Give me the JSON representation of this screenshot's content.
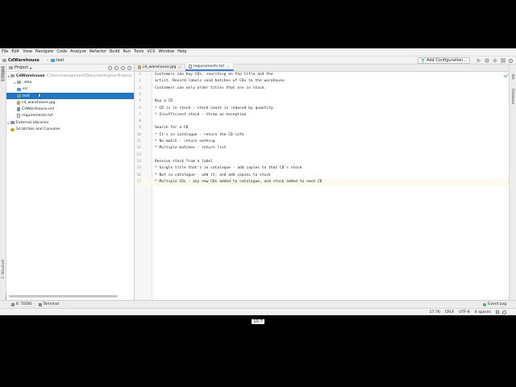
{
  "menu": [
    "File",
    "Edit",
    "View",
    "Navigate",
    "Code",
    "Analyze",
    "Refactor",
    "Build",
    "Run",
    "Tools",
    "VCS",
    "Window",
    "Help"
  ],
  "breadcrumb": {
    "project": "CdWarehouse",
    "folder": "test"
  },
  "toolbar": {
    "add_configuration": "Add Configuration..."
  },
  "project_panel": {
    "title": "Project",
    "tree": [
      {
        "label": "CdWarehouse",
        "path": "C:\\Users\\assignment\\Documents\\Java Projects",
        "icon": "folder-icon"
      },
      {
        "label": ".idea",
        "icon": "folder-icon"
      },
      {
        "label": "src",
        "icon": "source-folder-icon"
      },
      {
        "label": "test",
        "icon": "test-folder-icon"
      },
      {
        "label": "cd_warehouse.jpg",
        "icon": "image-file-icon"
      },
      {
        "label": "CdWarehouse.iml",
        "icon": "module-file-icon"
      },
      {
        "label": "requirements.txt",
        "icon": "text-file-icon"
      },
      {
        "label": "External Libraries",
        "icon": "library-icon"
      },
      {
        "label": "Scratches and Consoles",
        "icon": "scratch-icon"
      }
    ]
  },
  "editor": {
    "tabs": [
      {
        "label": "cd_warehouse.jpg",
        "active": false
      },
      {
        "label": "requirements.txt",
        "active": true
      }
    ],
    "lines": [
      {
        "n": "1",
        "text": "Customers can buy CDs, searching on the title and the"
      },
      {
        "n": "2",
        "text": "artist. Record labels send batches of CDs to the warehouse."
      },
      {
        "n": "3",
        "text": "Customers can only order titles that are in stock."
      },
      {
        "n": "4",
        "text": ""
      },
      {
        "n": "5",
        "text": "Buy a CD"
      },
      {
        "n": "6",
        "text": "* CD is in stock - stock count is reduced by quantity"
      },
      {
        "n": "7",
        "text": "* Insufficient stock - throw an exception"
      },
      {
        "n": "8",
        "text": ""
      },
      {
        "n": "9",
        "text": "Search for a CD"
      },
      {
        "n": "10",
        "text": "* It's in catalogue - return the CD info"
      },
      {
        "n": "11",
        "text": "* No match - return nothing"
      },
      {
        "n": "12",
        "text": "* Multiple matches - return list"
      },
      {
        "n": "13",
        "text": ""
      },
      {
        "n": "14",
        "text": "Receive stock from a label"
      },
      {
        "n": "15",
        "text": "* Single title that's in catalogue - add copies to that CD's stock"
      },
      {
        "n": "16",
        "text": "* Not in catalogue - add it, and add copies to stock"
      },
      {
        "n": "17",
        "text": "* Multiple CDs - any new CDs added to catalogue, and stock added to each CD"
      }
    ]
  },
  "left_strip": {
    "project": "1: Project",
    "structure": "2: Structure",
    "favorites": "2: Favorites"
  },
  "right_strip": {
    "ant": "Ant",
    "database": "Database"
  },
  "bottom_tools": {
    "todo": "6: TODO",
    "terminal": "Terminal",
    "event_log": "Event Log"
  },
  "status": {
    "position": "17:76",
    "line_sep": "CRLF",
    "encoding": "UTF-8",
    "indent": "4 spaces"
  },
  "caption": "10:7"
}
